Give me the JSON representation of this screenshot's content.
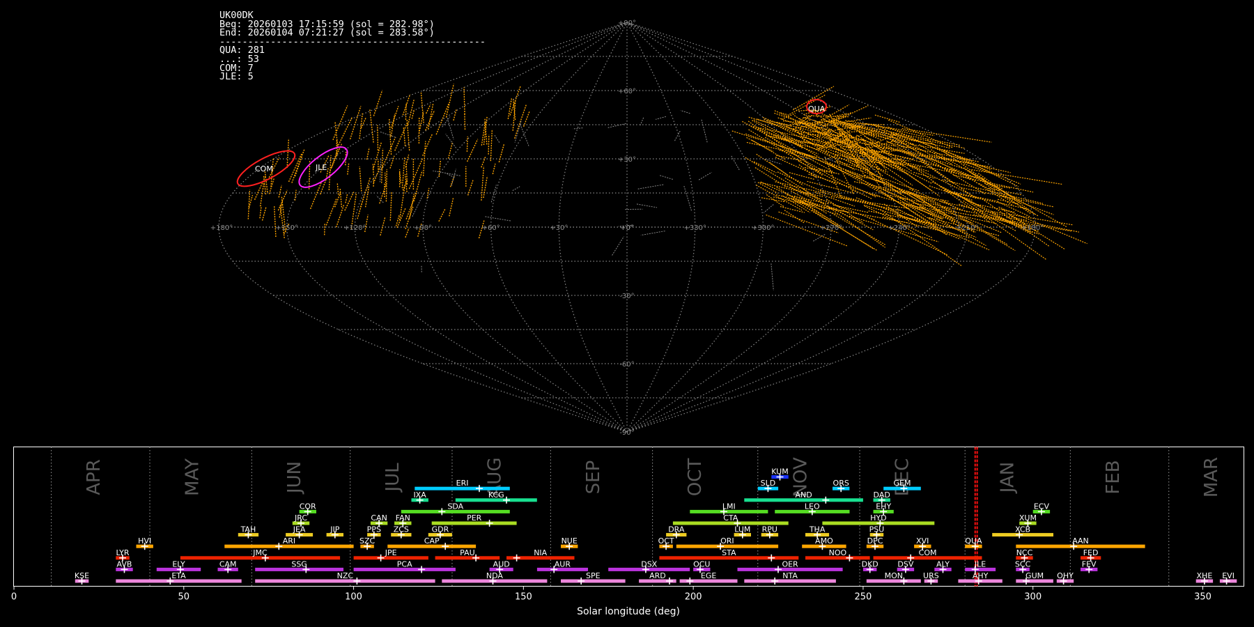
{
  "info": {
    "station": "UK00DK",
    "begin": "Beg: 20260103 17:15:59 (sol = 282.98°)",
    "end": "End: 20260104 07:21:27 (sol = 283.58°)",
    "separator": "-----------------------------------------------",
    "counts": [
      {
        "code": "QUA",
        "count": 281
      },
      {
        "code": "...",
        "count": 53
      },
      {
        "code": "COM",
        "count": 7
      },
      {
        "code": "JLE",
        "count": 5
      }
    ]
  },
  "sky_map": {
    "projection": "sinusoidal",
    "lon_ticks": [
      "+180°",
      "+150°",
      "+120°",
      "+90°",
      "+60°",
      "+30°",
      "+0°",
      "+330°",
      "+300°",
      "+270°",
      "+240°",
      "+210°",
      "+180°"
    ],
    "lat_ticks": [
      "+90°",
      "+60°",
      "+30°",
      "+0°",
      "-30°",
      "-60°",
      "-90°"
    ],
    "radiants": [
      {
        "label": "COM",
        "color": "#ff2020"
      },
      {
        "label": "JLE",
        "color": "#ff20ff"
      },
      {
        "label": "QUA",
        "color": "#ff2020"
      }
    ],
    "colors": {
      "grid": "#8a8a8a",
      "meteor": "#ffa500",
      "sporadic": "#888888"
    }
  },
  "chart_data": {
    "type": "bar",
    "xlabel": "Solar longitude (deg)",
    "xlim": [
      0,
      362
    ],
    "x_ticks": [
      0,
      50,
      100,
      150,
      200,
      250,
      300,
      350
    ],
    "current_sol": [
      282.98,
      283.58
    ],
    "months": [
      {
        "name": "APR",
        "start": 11
      },
      {
        "name": "MAY",
        "start": 40
      },
      {
        "name": "JUN",
        "start": 70
      },
      {
        "name": "JUL",
        "start": 99
      },
      {
        "name": "AUG",
        "start": 129
      },
      {
        "name": "SEP",
        "start": 158
      },
      {
        "name": "OCT",
        "start": 188
      },
      {
        "name": "NOV",
        "start": 219
      },
      {
        "name": "DEC",
        "start": 249
      },
      {
        "name": "JAN",
        "start": 280
      },
      {
        "name": "FEB",
        "start": 311
      },
      {
        "name": "MAR",
        "start": 340
      }
    ],
    "showers": [
      {
        "code": "KUM",
        "start": 223,
        "end": 228,
        "peak": 225.5,
        "row": 9,
        "color": "#1a33ff"
      },
      {
        "code": "ERI",
        "start": 118,
        "end": 146,
        "peak": 137,
        "row": 8,
        "color": "#00ccff"
      },
      {
        "code": "SLD",
        "start": 219,
        "end": 225,
        "peak": 222,
        "row": 8,
        "color": "#00ccff"
      },
      {
        "code": "ORS",
        "start": 241,
        "end": 246,
        "peak": 243.5,
        "row": 8,
        "color": "#00ccff"
      },
      {
        "code": "GEM",
        "start": 256,
        "end": 267,
        "peak": 262,
        "row": 8,
        "color": "#00ccff"
      },
      {
        "code": "IXA",
        "start": 117,
        "end": 122,
        "peak": 119.5,
        "row": 7,
        "color": "#18e090"
      },
      {
        "code": "KCG",
        "start": 130,
        "end": 154,
        "peak": 145,
        "row": 7,
        "color": "#18e090"
      },
      {
        "code": "AND",
        "start": 215,
        "end": 250,
        "peak": 239,
        "row": 7,
        "color": "#18e090"
      },
      {
        "code": "DAD",
        "start": 253,
        "end": 258,
        "peak": 255.5,
        "row": 7,
        "color": "#18e090"
      },
      {
        "code": "COR",
        "start": 84,
        "end": 89,
        "peak": 86.5,
        "row": 6,
        "color": "#55dd22"
      },
      {
        "code": "SDA",
        "start": 114,
        "end": 146,
        "peak": 126,
        "row": 6,
        "color": "#55dd22"
      },
      {
        "code": "LMI",
        "start": 199,
        "end": 222,
        "peak": 209,
        "row": 6,
        "color": "#55dd22"
      },
      {
        "code": "LEO",
        "start": 224,
        "end": 246,
        "peak": 235,
        "row": 6,
        "color": "#55dd22"
      },
      {
        "code": "EHY",
        "start": 253,
        "end": 259,
        "peak": 256,
        "row": 6,
        "color": "#55dd22"
      },
      {
        "code": "ECV",
        "start": 300,
        "end": 305,
        "peak": 302.5,
        "row": 6,
        "color": "#55dd22"
      },
      {
        "code": "JRC",
        "start": 82,
        "end": 87,
        "peak": 84.5,
        "row": 5,
        "color": "#aadd22"
      },
      {
        "code": "CAN",
        "start": 105,
        "end": 110,
        "peak": 107.5,
        "row": 5,
        "color": "#aadd22"
      },
      {
        "code": "FAN",
        "start": 112,
        "end": 117,
        "peak": 114.5,
        "row": 5,
        "color": "#aadd22"
      },
      {
        "code": "PER",
        "start": 123,
        "end": 148,
        "peak": 140,
        "row": 5,
        "color": "#aadd22"
      },
      {
        "code": "CTA",
        "start": 194,
        "end": 228,
        "peak": 213,
        "row": 5,
        "color": "#aadd22"
      },
      {
        "code": "HYD",
        "start": 238,
        "end": 271,
        "peak": 255,
        "row": 5,
        "color": "#aadd22"
      },
      {
        "code": "XUM",
        "start": 296,
        "end": 301,
        "peak": 298.5,
        "row": 5,
        "color": "#aadd22"
      },
      {
        "code": "TAH",
        "start": 66,
        "end": 72,
        "peak": 69,
        "row": 4,
        "color": "#eecc22"
      },
      {
        "code": "JEA",
        "start": 80,
        "end": 88,
        "peak": 84,
        "row": 4,
        "color": "#eecc22"
      },
      {
        "code": "JIP",
        "start": 92,
        "end": 97,
        "peak": 94.5,
        "row": 4,
        "color": "#eecc22"
      },
      {
        "code": "PPS",
        "start": 104,
        "end": 108,
        "peak": 106,
        "row": 4,
        "color": "#eecc22"
      },
      {
        "code": "ZCS",
        "start": 111,
        "end": 117,
        "peak": 114,
        "row": 4,
        "color": "#eecc22"
      },
      {
        "code": "GDR",
        "start": 122,
        "end": 129,
        "peak": 125.5,
        "row": 4,
        "color": "#eecc22"
      },
      {
        "code": "DRA",
        "start": 192,
        "end": 198,
        "peak": 195,
        "row": 4,
        "color": "#eecc22"
      },
      {
        "code": "LUM",
        "start": 212,
        "end": 217,
        "peak": 214.5,
        "row": 4,
        "color": "#eecc22"
      },
      {
        "code": "RPU",
        "start": 220,
        "end": 225,
        "peak": 222.5,
        "row": 4,
        "color": "#eecc22"
      },
      {
        "code": "THA",
        "start": 233,
        "end": 240,
        "peak": 236.5,
        "row": 4,
        "color": "#eecc22"
      },
      {
        "code": "PSU",
        "start": 252,
        "end": 256,
        "peak": 254,
        "row": 4,
        "color": "#eecc22"
      },
      {
        "code": "XCB",
        "start": 288,
        "end": 306,
        "peak": 296,
        "row": 4,
        "color": "#eecc22"
      },
      {
        "code": "HVI",
        "start": 36,
        "end": 41,
        "peak": 38.5,
        "row": 3,
        "color": "#ffa500"
      },
      {
        "code": "ARI",
        "start": 62,
        "end": 100,
        "peak": 78,
        "row": 3,
        "color": "#ffa500"
      },
      {
        "code": "SZC",
        "start": 102,
        "end": 106,
        "peak": 104,
        "row": 3,
        "color": "#ffa500"
      },
      {
        "code": "CAP",
        "start": 110,
        "end": 136,
        "peak": 127,
        "row": 3,
        "color": "#ffa500"
      },
      {
        "code": "NUE",
        "start": 161,
        "end": 166,
        "peak": 163.5,
        "row": 3,
        "color": "#ffa500"
      },
      {
        "code": "OCT",
        "start": 190,
        "end": 194,
        "peak": 192,
        "row": 3,
        "color": "#ffa500"
      },
      {
        "code": "ORI",
        "start": 195,
        "end": 225,
        "peak": 208,
        "row": 3,
        "color": "#ffa500"
      },
      {
        "code": "AMO",
        "start": 232,
        "end": 245,
        "peak": 238,
        "row": 3,
        "color": "#ffa500"
      },
      {
        "code": "DPC",
        "start": 251,
        "end": 256,
        "peak": 253.5,
        "row": 3,
        "color": "#ffa500"
      },
      {
        "code": "XVI",
        "start": 265,
        "end": 270,
        "peak": 267.5,
        "row": 3,
        "color": "#ffa500"
      },
      {
        "code": "QUA",
        "start": 280,
        "end": 285,
        "peak": 283,
        "row": 3,
        "color": "#ffa500"
      },
      {
        "code": "AAN",
        "start": 295,
        "end": 333,
        "peak": 312,
        "row": 3,
        "color": "#ffa500"
      },
      {
        "code": "LYR",
        "start": 30,
        "end": 34,
        "peak": 32,
        "row": 2,
        "color": "#ee2200"
      },
      {
        "code": "JMC",
        "start": 49,
        "end": 96,
        "peak": 74,
        "row": 2,
        "color": "#ee2200"
      },
      {
        "code": "JPE",
        "start": 100,
        "end": 122,
        "peak": 108,
        "row": 2,
        "color": "#ee2200"
      },
      {
        "code": "PAU",
        "start": 124,
        "end": 143,
        "peak": 136,
        "row": 2,
        "color": "#ee2200"
      },
      {
        "code": "NIA",
        "start": 145,
        "end": 165,
        "peak": 148,
        "row": 2,
        "color": "#ee2200"
      },
      {
        "code": "STA",
        "start": 190,
        "end": 231,
        "peak": 223,
        "row": 2,
        "color": "#ee2200"
      },
      {
        "code": "NOO",
        "start": 233,
        "end": 252,
        "peak": 246,
        "row": 2,
        "color": "#ee2200"
      },
      {
        "code": "COM",
        "start": 253,
        "end": 285,
        "peak": 264,
        "row": 2,
        "color": "#ee2200"
      },
      {
        "code": "NCC",
        "start": 295,
        "end": 300,
        "peak": 297.5,
        "row": 2,
        "color": "#ee2200"
      },
      {
        "code": "FED",
        "start": 314,
        "end": 320,
        "peak": 317,
        "row": 2,
        "color": "#ee2200"
      },
      {
        "code": "AVB",
        "start": 30,
        "end": 35,
        "peak": 32.5,
        "row": 1,
        "color": "#bb33dd"
      },
      {
        "code": "ELY",
        "start": 42,
        "end": 55,
        "peak": 49,
        "row": 1,
        "color": "#bb33dd"
      },
      {
        "code": "CAM",
        "start": 60,
        "end": 66,
        "peak": 63,
        "row": 1,
        "color": "#bb33dd"
      },
      {
        "code": "SSG",
        "start": 71,
        "end": 97,
        "peak": 86,
        "row": 1,
        "color": "#bb33dd"
      },
      {
        "code": "PCA",
        "start": 100,
        "end": 130,
        "peak": 120,
        "row": 1,
        "color": "#bb33dd"
      },
      {
        "code": "AUD",
        "start": 140,
        "end": 147,
        "peak": 143,
        "row": 1,
        "color": "#bb33dd"
      },
      {
        "code": "AUR",
        "start": 154,
        "end": 169,
        "peak": 159,
        "row": 1,
        "color": "#bb33dd"
      },
      {
        "code": "DSX",
        "start": 175,
        "end": 199,
        "peak": 186,
        "row": 1,
        "color": "#bb33dd"
      },
      {
        "code": "OCU",
        "start": 200,
        "end": 205,
        "peak": 202,
        "row": 1,
        "color": "#bb33dd"
      },
      {
        "code": "OER",
        "start": 213,
        "end": 244,
        "peak": 225,
        "row": 1,
        "color": "#bb33dd"
      },
      {
        "code": "DKD",
        "start": 250,
        "end": 254,
        "peak": 252,
        "row": 1,
        "color": "#bb33dd"
      },
      {
        "code": "DSV",
        "start": 260,
        "end": 265,
        "peak": 262.5,
        "row": 1,
        "color": "#bb33dd"
      },
      {
        "code": "ALY",
        "start": 271,
        "end": 276,
        "peak": 273.5,
        "row": 1,
        "color": "#bb33dd"
      },
      {
        "code": "JLE",
        "start": 280,
        "end": 289,
        "peak": 283,
        "row": 1,
        "color": "#bb33dd"
      },
      {
        "code": "SCC",
        "start": 295,
        "end": 299,
        "peak": 297,
        "row": 1,
        "color": "#bb33dd"
      },
      {
        "code": "FEV",
        "start": 314,
        "end": 319,
        "peak": 316.5,
        "row": 1,
        "color": "#bb33dd"
      },
      {
        "code": "KSE",
        "start": 18,
        "end": 22,
        "peak": 20,
        "row": 0,
        "color": "#ee88dd"
      },
      {
        "code": "ETA",
        "start": 30,
        "end": 67,
        "peak": 46,
        "row": 0,
        "color": "#ee88dd"
      },
      {
        "code": "NZC",
        "start": 71,
        "end": 124,
        "peak": 101,
        "row": 0,
        "color": "#ee88dd"
      },
      {
        "code": "NDA",
        "start": 126,
        "end": 157,
        "peak": 141,
        "row": 0,
        "color": "#ee88dd"
      },
      {
        "code": "SPE",
        "start": 161,
        "end": 180,
        "peak": 167,
        "row": 0,
        "color": "#ee88dd"
      },
      {
        "code": "ARD",
        "start": 184,
        "end": 195,
        "peak": 193,
        "row": 0,
        "color": "#ee88dd"
      },
      {
        "code": "EGE",
        "start": 196,
        "end": 213,
        "peak": 199,
        "row": 0,
        "color": "#ee88dd"
      },
      {
        "code": "NTA",
        "start": 215,
        "end": 242,
        "peak": 224,
        "row": 0,
        "color": "#ee88dd"
      },
      {
        "code": "MON",
        "start": 251,
        "end": 267,
        "peak": 262,
        "row": 0,
        "color": "#ee88dd"
      },
      {
        "code": "URS",
        "start": 268,
        "end": 272,
        "peak": 270,
        "row": 0,
        "color": "#ee88dd"
      },
      {
        "code": "AHY",
        "start": 278,
        "end": 291,
        "peak": 284,
        "row": 0,
        "color": "#ee88dd"
      },
      {
        "code": "GUM",
        "start": 295,
        "end": 306,
        "peak": 298,
        "row": 0,
        "color": "#ee88dd"
      },
      {
        "code": "OHY",
        "start": 307,
        "end": 312,
        "peak": 309,
        "row": 0,
        "color": "#ee88dd"
      },
      {
        "code": "XHE",
        "start": 348,
        "end": 353,
        "peak": 350.5,
        "row": 0,
        "color": "#ee88dd"
      },
      {
        "code": "EVI",
        "start": 355,
        "end": 360,
        "peak": 357,
        "row": 0,
        "color": "#ee88dd"
      }
    ]
  }
}
